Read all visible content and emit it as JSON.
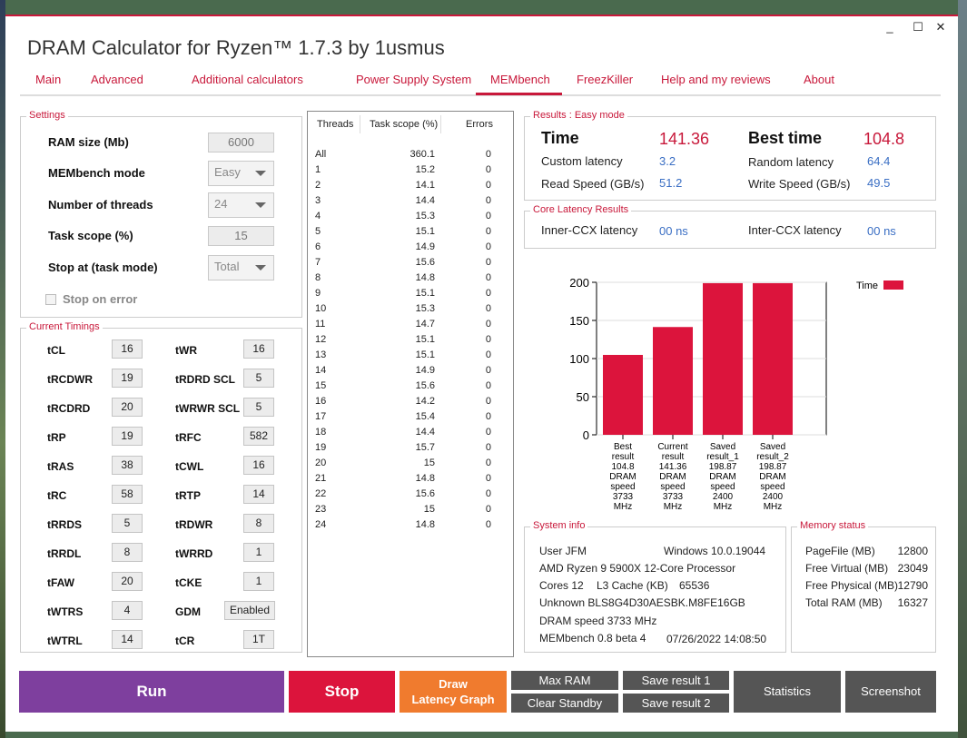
{
  "window": {
    "title": "DRAM Calculator for Ryzen™ 1.7.3 by 1usmus",
    "controls": {
      "minimize": "_",
      "maximize": "☐",
      "close": "✕"
    }
  },
  "tabs": [
    "Main",
    "Advanced",
    "Additional calculators",
    "Power Supply System",
    "MEMbench",
    "FreezKiller",
    "Help and my reviews",
    "About"
  ],
  "active_tab": "MEMbench",
  "settings": {
    "title": "Settings",
    "ram_size_label": "RAM size (Mb)",
    "ram_size_value": "6000",
    "mode_label": "MEMbench mode",
    "mode_value": "Easy",
    "threads_label": "Number of threads",
    "threads_value": "24",
    "task_scope_label": "Task scope (%)",
    "task_scope_value": "15",
    "stop_at_label": "Stop at (task mode)",
    "stop_at_value": "Total",
    "stop_on_error_label": "Stop on error"
  },
  "timings": {
    "title": "Current Timings",
    "left": [
      {
        "name": "tCL",
        "value": "16"
      },
      {
        "name": "tRCDWR",
        "value": "19"
      },
      {
        "name": "tRCDRD",
        "value": "20"
      },
      {
        "name": "tRP",
        "value": "19"
      },
      {
        "name": "tRAS",
        "value": "38"
      },
      {
        "name": "tRC",
        "value": "58"
      },
      {
        "name": "tRRDS",
        "value": "5"
      },
      {
        "name": "tRRDL",
        "value": "8"
      },
      {
        "name": "tFAW",
        "value": "20"
      },
      {
        "name": "tWTRS",
        "value": "4"
      },
      {
        "name": "tWTRL",
        "value": "14"
      }
    ],
    "right": [
      {
        "name": "tWR",
        "value": "16"
      },
      {
        "name": "tRDRD SCL",
        "value": "5"
      },
      {
        "name": "tWRWR SCL",
        "value": "5"
      },
      {
        "name": "tRFC",
        "value": "582"
      },
      {
        "name": "tCWL",
        "value": "16"
      },
      {
        "name": "tRTP",
        "value": "14"
      },
      {
        "name": "tRDWR",
        "value": "8"
      },
      {
        "name": "tWRRD",
        "value": "1"
      },
      {
        "name": "tCKE",
        "value": "1"
      },
      {
        "name": "GDM",
        "value": "Enabled"
      },
      {
        "name": "tCR",
        "value": "1T"
      }
    ]
  },
  "threads_table": {
    "headers": [
      "Threads",
      "Task scope (%)",
      "Errors"
    ],
    "rows": [
      [
        "All",
        "360.1",
        "0"
      ],
      [
        "1",
        "15.2",
        "0"
      ],
      [
        "2",
        "14.1",
        "0"
      ],
      [
        "3",
        "14.4",
        "0"
      ],
      [
        "4",
        "15.3",
        "0"
      ],
      [
        "5",
        "15.1",
        "0"
      ],
      [
        "6",
        "14.9",
        "0"
      ],
      [
        "7",
        "15.6",
        "0"
      ],
      [
        "8",
        "14.8",
        "0"
      ],
      [
        "9",
        "15.1",
        "0"
      ],
      [
        "10",
        "15.3",
        "0"
      ],
      [
        "11",
        "14.7",
        "0"
      ],
      [
        "12",
        "15.1",
        "0"
      ],
      [
        "13",
        "15.1",
        "0"
      ],
      [
        "14",
        "14.9",
        "0"
      ],
      [
        "15",
        "15.6",
        "0"
      ],
      [
        "16",
        "14.2",
        "0"
      ],
      [
        "17",
        "15.4",
        "0"
      ],
      [
        "18",
        "14.4",
        "0"
      ],
      [
        "19",
        "15.7",
        "0"
      ],
      [
        "20",
        "15",
        "0"
      ],
      [
        "21",
        "14.8",
        "0"
      ],
      [
        "22",
        "15.6",
        "0"
      ],
      [
        "23",
        "15",
        "0"
      ],
      [
        "24",
        "14.8",
        "0"
      ]
    ]
  },
  "results": {
    "title": "Results : Easy mode",
    "time_label": "Time",
    "time_value": "141.36",
    "best_label": "Best time",
    "best_value": "104.8",
    "custom_latency_label": "Custom latency",
    "custom_latency_value": "3.2",
    "random_latency_label": "Random latency",
    "random_latency_value": "64.4",
    "read_label": "Read Speed (GB/s)",
    "read_value": "51.2",
    "write_label": "Write Speed (GB/s)",
    "write_value": "49.5"
  },
  "core_latency": {
    "title": "Core Latency Results",
    "inner_label": "Inner-CCX latency",
    "inner_value": "00 ns",
    "inter_label": "Inter-CCX latency",
    "inter_value": "00 ns"
  },
  "chart_data": {
    "type": "bar",
    "categories": [
      "Best result 104.8 DRAM speed 3733 MHz",
      "Current result 141.36 DRAM speed 3733 MHz",
      "Saved result_1 198.87 DRAM speed 2400 MHz",
      "Saved result_2 198.87 DRAM speed 2400 MHz"
    ],
    "category_lines": [
      [
        "Best",
        "result",
        "104.8",
        "DRAM",
        "speed",
        "3733",
        "MHz"
      ],
      [
        "Current",
        "result",
        "141.36",
        "DRAM",
        "speed",
        "3733",
        "MHz"
      ],
      [
        "Saved",
        "result_1",
        "198.87",
        "DRAM",
        "speed",
        "2400",
        "MHz"
      ],
      [
        "Saved",
        "result_2",
        "198.87",
        "DRAM",
        "speed",
        "2400",
        "MHz"
      ]
    ],
    "series": [
      {
        "name": "Time",
        "values": [
          104.8,
          141.36,
          198.87,
          198.87
        ]
      }
    ],
    "yticks": [
      0,
      50,
      100,
      150,
      200
    ],
    "ylim": [
      0,
      200
    ],
    "grid": true,
    "legend": "top-right",
    "color": "#dc143c"
  },
  "system_info": {
    "title": "System info",
    "user": "User JFM",
    "os": "Windows 10.0.19044",
    "cpu": "AMD Ryzen 9 5900X 12-Core Processor",
    "cores": "Cores 12",
    "l3_label": "L3 Cache (KB)",
    "l3_value": "65536",
    "memory": "Unknown BLS8G4D30AESBK.M8FE16GB",
    "dram_speed": "DRAM speed 3733 MHz",
    "version": "MEMbench 0.8 beta 4",
    "datetime": "07/26/2022 14:08:50"
  },
  "memory_status": {
    "title": "Memory status",
    "rows": [
      {
        "label": "PageFile (MB)",
        "value": "12800"
      },
      {
        "label": "Free Virtual (MB)",
        "value": "23049"
      },
      {
        "label": "Free Physical (MB)",
        "value": "12790"
      },
      {
        "label": "Total RAM (MB)",
        "value": "16327"
      }
    ]
  },
  "buttons": {
    "run": "Run",
    "stop": "Stop",
    "draw_line1": "Draw",
    "draw_line2": "Latency Graph",
    "max_ram": "Max RAM",
    "clear_standby": "Clear Standby",
    "save1": "Save result 1",
    "save2": "Save result 2",
    "statistics": "Statistics",
    "screenshot": "Screenshot"
  },
  "colors": {
    "accent": "#c8183a",
    "run": "#7e3f9e",
    "stop": "#dc143c",
    "draw": "#f07b2e",
    "gray_button": "#555555",
    "value_blue": "#3b6fc4"
  }
}
